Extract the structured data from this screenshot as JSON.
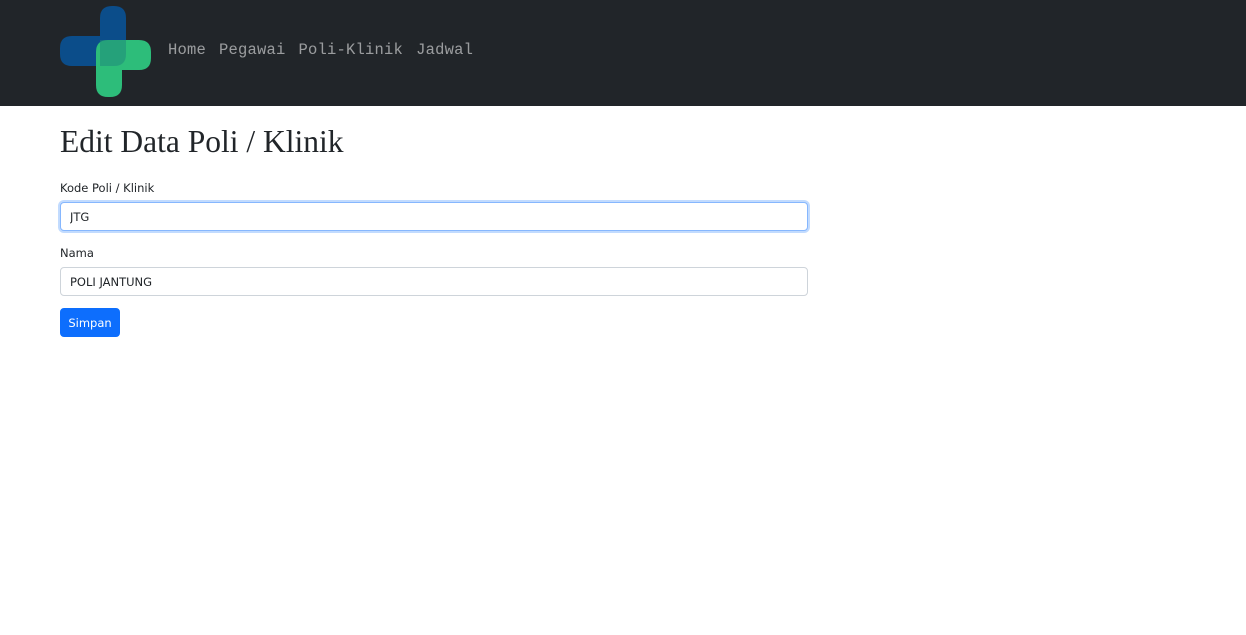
{
  "navbar": {
    "logo_icon": "medical-cross-logo",
    "links": [
      {
        "label": "Home"
      },
      {
        "label": "Pegawai"
      },
      {
        "label": "Poli-Klinik"
      },
      {
        "label": "Jadwal"
      }
    ]
  },
  "page": {
    "title": "Edit Data Poli / Klinik"
  },
  "form": {
    "kode": {
      "label": "Kode Poli / Klinik",
      "value": "JTG"
    },
    "nama": {
      "label": "Nama",
      "value": "POLI JANTUNG"
    },
    "submit_label": "Simpan"
  },
  "colors": {
    "navbar_bg": "#212529",
    "logo_blue": "#0b4d8a",
    "logo_green": "#2dbd7a",
    "primary": "#0d6efd"
  }
}
